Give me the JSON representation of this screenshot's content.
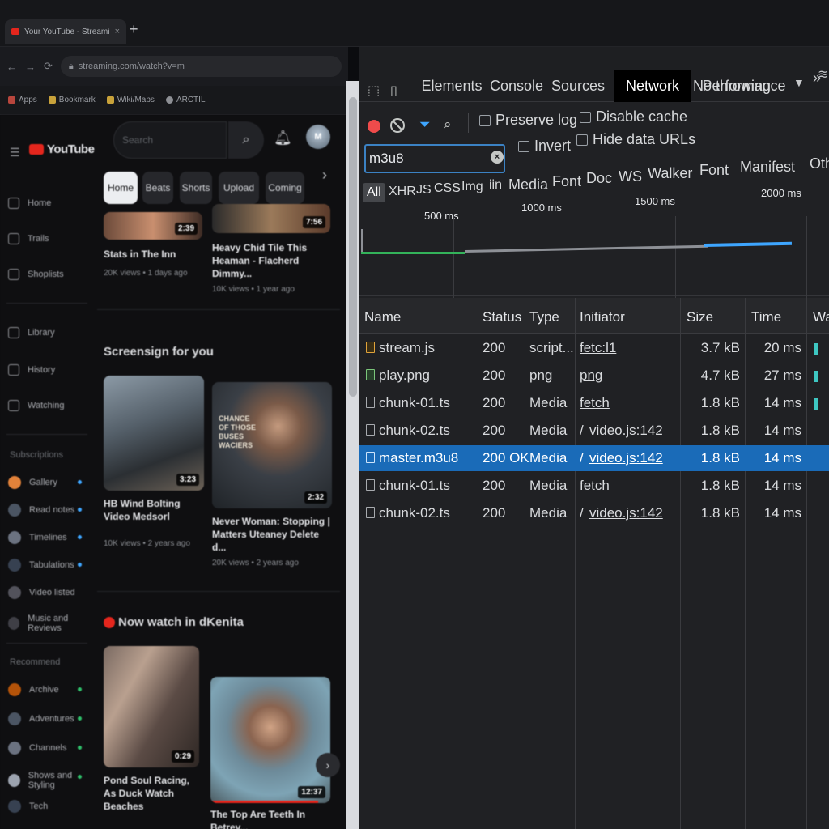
{
  "browser": {
    "tab_title": "Your YouTube - Streaming Plan",
    "tab_close": "×",
    "new_tab": "+",
    "address": "streaming.com/watch?v=m",
    "bookmarks": [
      "Apps",
      "Bookmark",
      "Wiki/Maps",
      "ARCTIL"
    ],
    "nav_icons": [
      "back-icon",
      "forward-icon",
      "reload-icon"
    ]
  },
  "youtube": {
    "logo_text": "YouTube",
    "search_placeholder": "Search",
    "avatar_initial": "M",
    "chips": [
      "Home",
      "Beats",
      "Shorts",
      "Upload",
      "Coming"
    ],
    "chip_arrow": "›",
    "sidebar": {
      "main": [
        "Home",
        "Trails",
        "Shoplists"
      ],
      "library": [
        "Library",
        "History",
        "Watching"
      ],
      "subs_heading": "Subscriptions",
      "subs": [
        "Gallery",
        "Read notes",
        "Timelines",
        "Tabulations",
        "Video listed",
        "Music and Reviews"
      ],
      "more_heading": "Recommend",
      "more": [
        "Archive",
        "Adventures",
        "Channels",
        "Shows and Styling",
        "Tech"
      ]
    },
    "top_row": [
      {
        "title": "Stats in The Inn",
        "meta": "20K views • 1 days ago",
        "duration": "2:39"
      },
      {
        "title": "Heavy Chid Tile This Heaman - Flacherd Dimmy...",
        "meta": "10K views • 1 year ago",
        "duration": "7:56"
      }
    ],
    "section1_title": "Screensign for you",
    "section1": [
      {
        "title": "HB Wind Bolting Video Medsorl",
        "meta": "10K views • 2 years ago",
        "duration": "3:23"
      },
      {
        "title": "Never Woman: Stopping | Matters Uteaney Delete d...",
        "meta": "20K views • 2 years ago",
        "duration": "2:32",
        "overlay": "CHANCE OF THOSE BUSES WACIERS"
      }
    ],
    "section2_title": "Now watch in dKenita",
    "section2": [
      {
        "title": "Pond Soul Racing, As Duck Watch Beaches",
        "duration": "0:29"
      },
      {
        "title": "The Top Are Teeth In Betrey...",
        "duration": "12:37"
      }
    ],
    "next_arrow": "›"
  },
  "devtools": {
    "tabs": [
      "Elements",
      "Console",
      "Sources",
      "Network",
      "Performance"
    ],
    "active_tab": "Network",
    "more": "»",
    "preserve_log": "Preserve log",
    "disable_cache": "Disable cache",
    "throttling": "No throwing",
    "throttling_caret": "▼",
    "filter_value": "m3u8",
    "filter_clear": "×",
    "invert": "Invert",
    "hide_data_urls": "Hide data URLs",
    "type_filters": [
      "All",
      "XHR",
      "JS",
      "CSS",
      "Img",
      "iin",
      "Media",
      "Font",
      "Doc",
      "WS",
      "Walker",
      "Font",
      "Manifest",
      "Oth"
    ],
    "overview_ticks": [
      "500 ms",
      "1000 ms",
      "1500 ms",
      "2000 ms"
    ],
    "columns": [
      "Name",
      "Status",
      "Type",
      "Initiator",
      "Size",
      "Time",
      "Wa"
    ],
    "rows": [
      {
        "name": "stream.js",
        "icon": "script-file-icon",
        "status": "200",
        "type": "script...",
        "initiator": "fetc:l1",
        "size": "3.7 kB",
        "time": "20 ms",
        "selected": false
      },
      {
        "name": "play.png",
        "icon": "image-file-icon",
        "status": "200",
        "type": "png",
        "initiator": "png",
        "size": "4.7 kB",
        "time": "27 ms",
        "selected": false
      },
      {
        "name": "chunk-01.ts",
        "icon": "file-icon",
        "status": "200",
        "type": "Media",
        "initiator": "fetch",
        "size": "1.8 kB",
        "time": "14 ms",
        "selected": false
      },
      {
        "name": "chunk-02.ts",
        "icon": "file-icon",
        "status": "200",
        "type": "Media",
        "initiator_prefix": "/",
        "initiator": "video.js:142",
        "size": "1.8 kB",
        "time": "14 ms",
        "selected": false
      },
      {
        "name": "master.m3u8",
        "icon": "file-icon",
        "status": "200 OK",
        "type": "Media",
        "initiator_prefix": "/",
        "initiator": "video.js:142",
        "size": "1.8 kB",
        "time": "14 ms",
        "selected": true
      },
      {
        "name": "chunk-01.ts",
        "icon": "file-icon",
        "status": "200",
        "type": "Media",
        "initiator": "fetch",
        "size": "1.8 kB",
        "time": "14 ms",
        "selected": false
      },
      {
        "name": "chunk-02.ts",
        "icon": "file-icon",
        "status": "200",
        "type": "Media",
        "initiator_prefix": "/",
        "initiator": "video.js:142",
        "size": "1.8 kB",
        "time": "14 ms",
        "selected": false
      }
    ],
    "colors": {
      "selected_row": "#1a6bb8",
      "record": "#ef4b4b",
      "filter_active": "#3ea6ff",
      "waterfall": "#3ec7c2"
    }
  }
}
